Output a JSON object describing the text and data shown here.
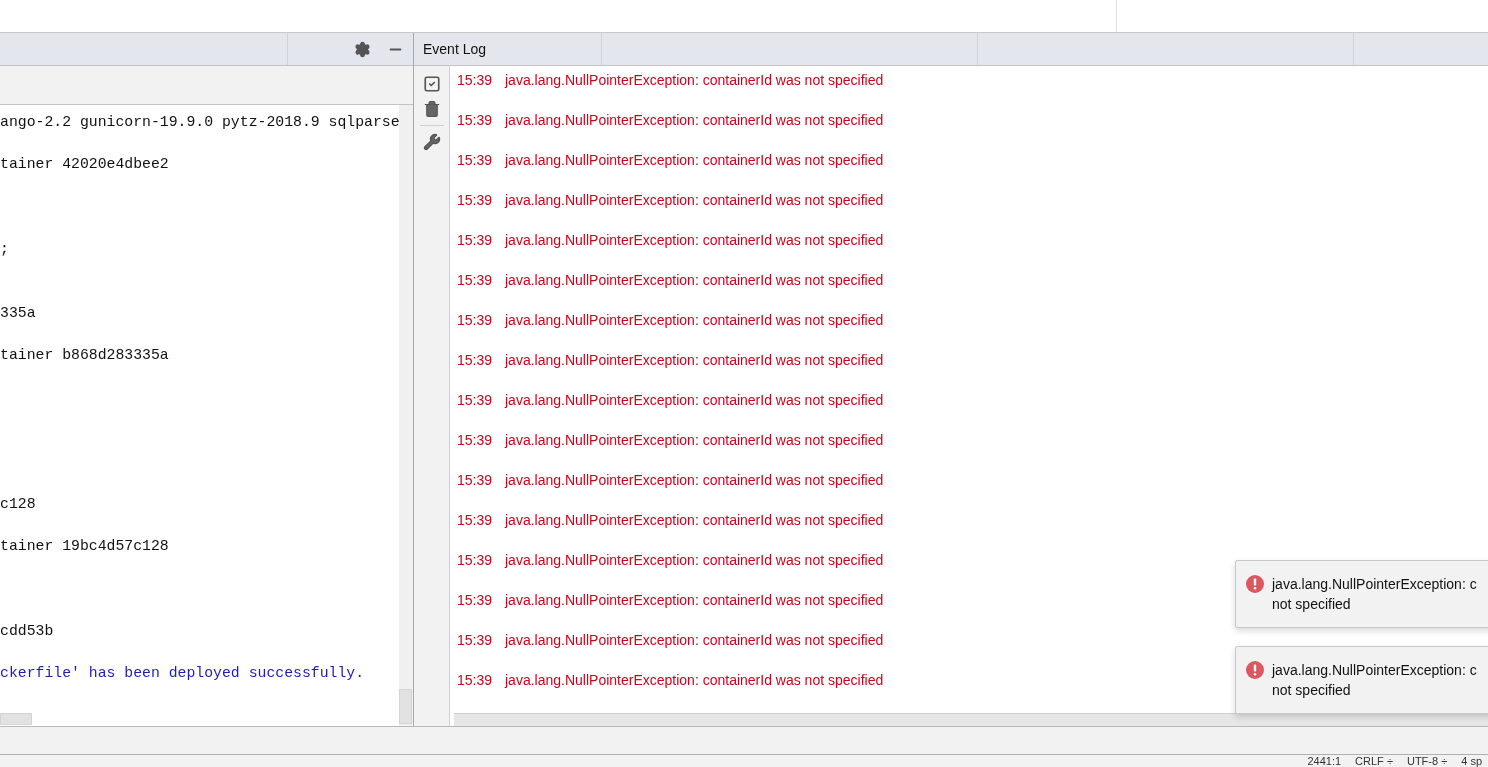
{
  "run_panel": {
    "console_lines": [
      {
        "text": "ango-2.2 gunicorn-19.9.0 pytz-2018.9 sqlparse",
        "kind": "plain"
      },
      {
        "text": "tainer 42020e4dbee2",
        "kind": "plain"
      },
      {
        "text": ";",
        "kind": "plain"
      },
      {
        "text": "335a",
        "kind": "plain"
      },
      {
        "text": "tainer b868d283335a",
        "kind": "plain"
      },
      {
        "text": "c128",
        "kind": "plain"
      },
      {
        "text": "tainer 19bc4d57c128",
        "kind": "plain"
      },
      {
        "text": "cdd53b",
        "kind": "plain"
      },
      {
        "text": "ckerfile' has been deployed successfully.",
        "kind": "info"
      }
    ]
  },
  "event_log": {
    "title": "Event Log",
    "entries": [
      {
        "time": "15:39",
        "message": "java.lang.NullPointerException: containerId was not specified"
      },
      {
        "time": "15:39",
        "message": "java.lang.NullPointerException: containerId was not specified"
      },
      {
        "time": "15:39",
        "message": "java.lang.NullPointerException: containerId was not specified"
      },
      {
        "time": "15:39",
        "message": "java.lang.NullPointerException: containerId was not specified"
      },
      {
        "time": "15:39",
        "message": "java.lang.NullPointerException: containerId was not specified"
      },
      {
        "time": "15:39",
        "message": "java.lang.NullPointerException: containerId was not specified"
      },
      {
        "time": "15:39",
        "message": "java.lang.NullPointerException: containerId was not specified"
      },
      {
        "time": "15:39",
        "message": "java.lang.NullPointerException: containerId was not specified"
      },
      {
        "time": "15:39",
        "message": "java.lang.NullPointerException: containerId was not specified"
      },
      {
        "time": "15:39",
        "message": "java.lang.NullPointerException: containerId was not specified"
      },
      {
        "time": "15:39",
        "message": "java.lang.NullPointerException: containerId was not specified"
      },
      {
        "time": "15:39",
        "message": "java.lang.NullPointerException: containerId was not specified"
      },
      {
        "time": "15:39",
        "message": "java.lang.NullPointerException: containerId was not specified"
      },
      {
        "time": "15:39",
        "message": "java.lang.NullPointerException: containerId was not specified"
      },
      {
        "time": "15:39",
        "message": "java.lang.NullPointerException: containerId was not specified"
      },
      {
        "time": "15:39",
        "message": "java.lang.NullPointerException: containerId was not specified"
      }
    ]
  },
  "notifications": [
    {
      "title": "java.lang.NullPointerException: c",
      "body": "not specified"
    },
    {
      "title": "java.lang.NullPointerException: c",
      "body": "not specified"
    }
  ],
  "status_bar": [
    "2441:1",
    "CRLF ÷",
    "UTF-8 ÷",
    "4 sp"
  ]
}
